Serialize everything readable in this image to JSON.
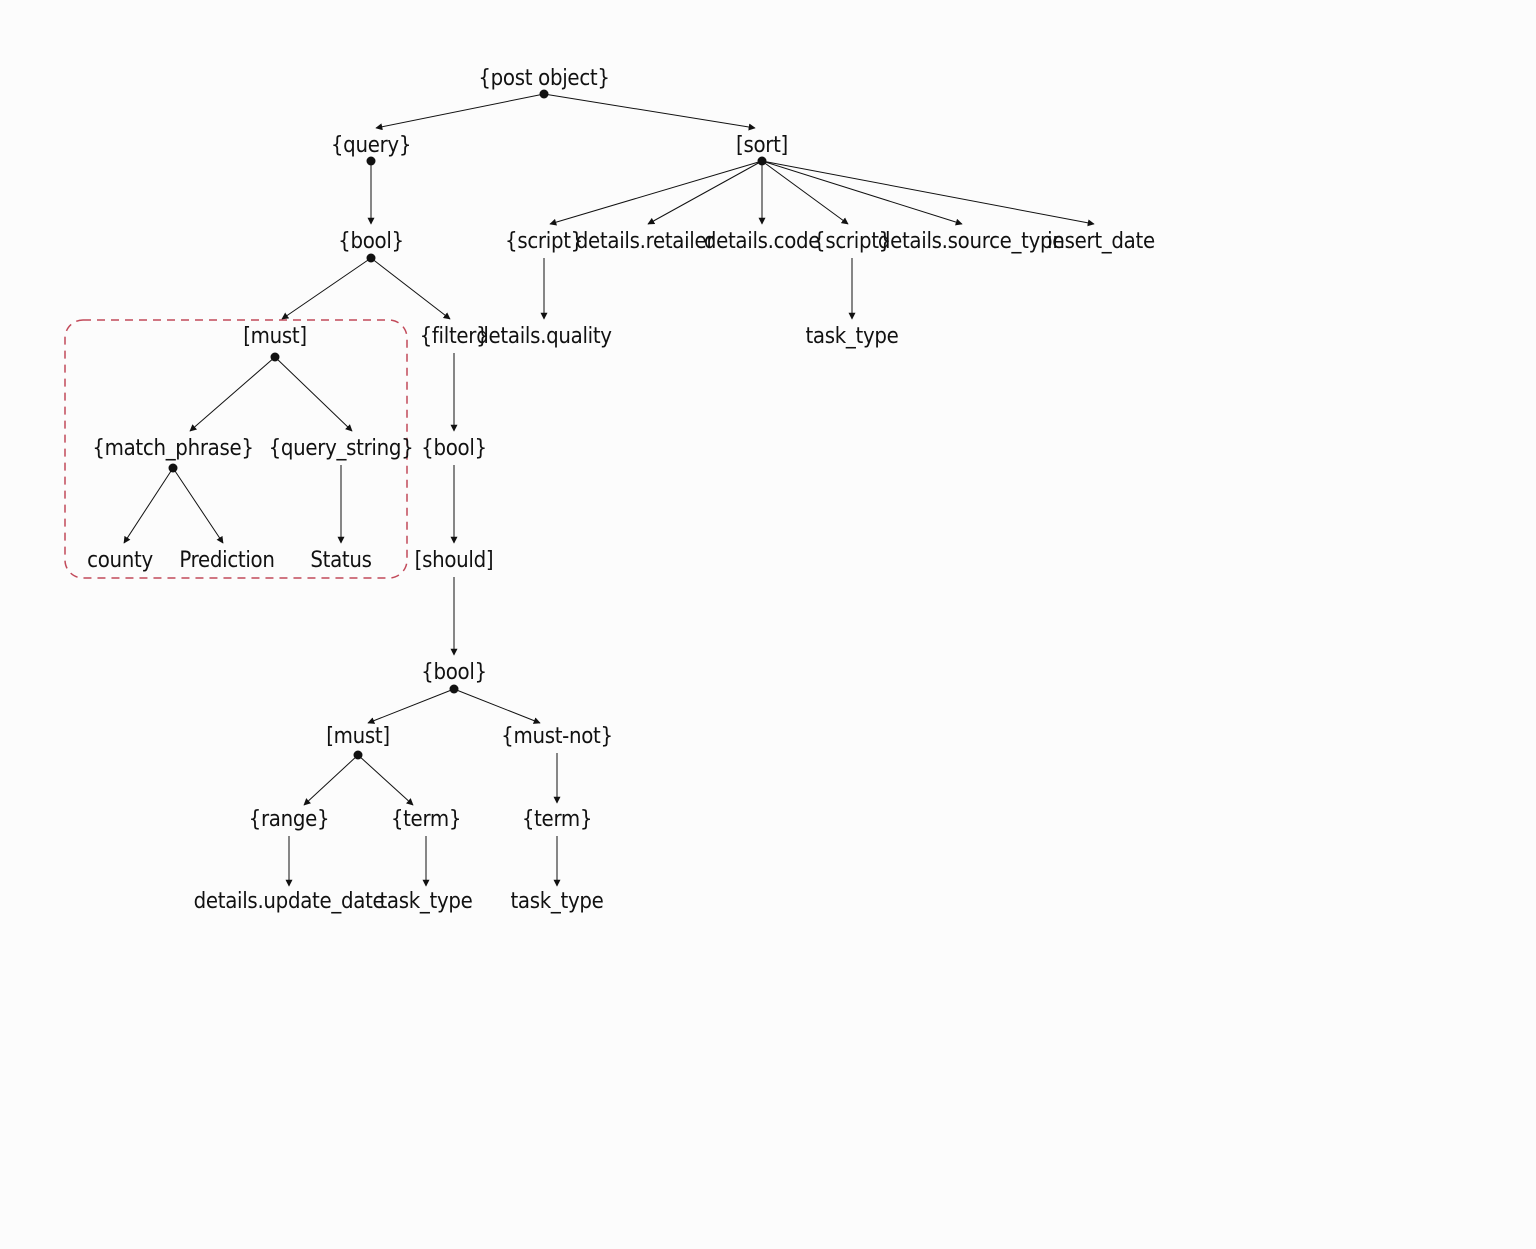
{
  "nodes": {
    "root": {
      "label": "{post object}"
    },
    "query": {
      "label": "{query}"
    },
    "sort": {
      "label": "[sort]"
    },
    "bool1": {
      "label": "{bool}"
    },
    "must1": {
      "label": "[must]"
    },
    "filter": {
      "label": "{filter}"
    },
    "match_phrase": {
      "label": "{match_phrase}"
    },
    "query_string": {
      "label": "{query_string}"
    },
    "county": {
      "label": "county"
    },
    "prediction": {
      "label": "Prediction"
    },
    "status": {
      "label": "Status"
    },
    "bool2": {
      "label": "{bool}"
    },
    "should": {
      "label": "[should]"
    },
    "bool3": {
      "label": "{bool}"
    },
    "must2": {
      "label": "[must]"
    },
    "must_not": {
      "label": "{must-not}"
    },
    "range": {
      "label": "{range}"
    },
    "term1": {
      "label": "{term}"
    },
    "term2": {
      "label": "{term}"
    },
    "update_date": {
      "label": "details.update_date"
    },
    "task_type_a": {
      "label": "task_type"
    },
    "task_type_b": {
      "label": "task_type"
    },
    "script1": {
      "label": "{script}"
    },
    "retailer": {
      "label": "details.retailer"
    },
    "code": {
      "label": "details.code"
    },
    "script2": {
      "label": "{script}"
    },
    "source_type": {
      "label": "details.source_type"
    },
    "insert_date": {
      "label": "insert_date"
    },
    "quality": {
      "label": "details.quality"
    },
    "task_type_c": {
      "label": "task_type"
    }
  },
  "highlight": {
    "color": "#c24a5a"
  }
}
